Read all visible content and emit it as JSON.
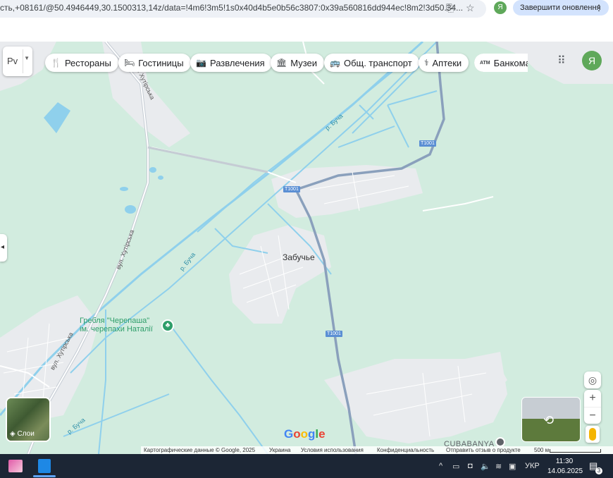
{
  "browser": {
    "url_text": "сть,+08161/@50.4946449,30.1500313,14z/data=!4m6!3m5!1s0x40d4b5e0b56c3807:0x39a560816dd944ec!8m2!3d50.34...",
    "profile_initial": "Я",
    "update_button_label": "Завершити оновлення",
    "install_icon": "install-app-icon",
    "bookmark_icon": "star-icon"
  },
  "maps_ui": {
    "language_selector": "Рv",
    "categories": [
      {
        "icon": "🍴",
        "label": "Рестораны"
      },
      {
        "icon": "🛏",
        "label": "Гостиницы"
      },
      {
        "icon": "📷",
        "label": "Развлечения"
      },
      {
        "icon": "🏛",
        "label": "Музеи"
      },
      {
        "icon": "🚌",
        "label": "Общ. транспорт"
      },
      {
        "icon": "⚕",
        "label": "Аптеки"
      },
      {
        "icon": "ATM",
        "label": "Банкоматы"
      }
    ],
    "account_initial": "Я",
    "layers_label": "Слои",
    "zoom_in": "+",
    "zoom_out": "−",
    "google_logo": "Google"
  },
  "map_labels": {
    "village": "Забучье",
    "river_1": "р. Буча",
    "river_2": "р. Буча",
    "river_3": "р. Буча",
    "street_1": "вул. Хутірська",
    "street_2": "вул. Хутірська",
    "street_3": "вул. Хутірська",
    "poi_line1": "Гребля \"Черепаша\"",
    "poi_line2": "ім. черепахи Наталії",
    "road_1": "T1001",
    "road_2": "T1001",
    "road_3": "T1001",
    "business": "CUBABANYA"
  },
  "attribution": {
    "copyright": "Картографические данные © Google, 2025",
    "country": "Украина",
    "terms": "Условия использования",
    "privacy": "Конфиденциальность",
    "feedback": "Отправить отзыв о продукте",
    "scale": "500 м"
  },
  "taskbar": {
    "language": "УКР",
    "time": "11:30",
    "date": "14.06.2025",
    "notification_count": "3"
  },
  "colors": {
    "land": "#d2ecdf",
    "water": "#8fd0ec",
    "road": "#8aa0bc",
    "urban": "#e9ebee",
    "taskbar": "#1c2635"
  }
}
